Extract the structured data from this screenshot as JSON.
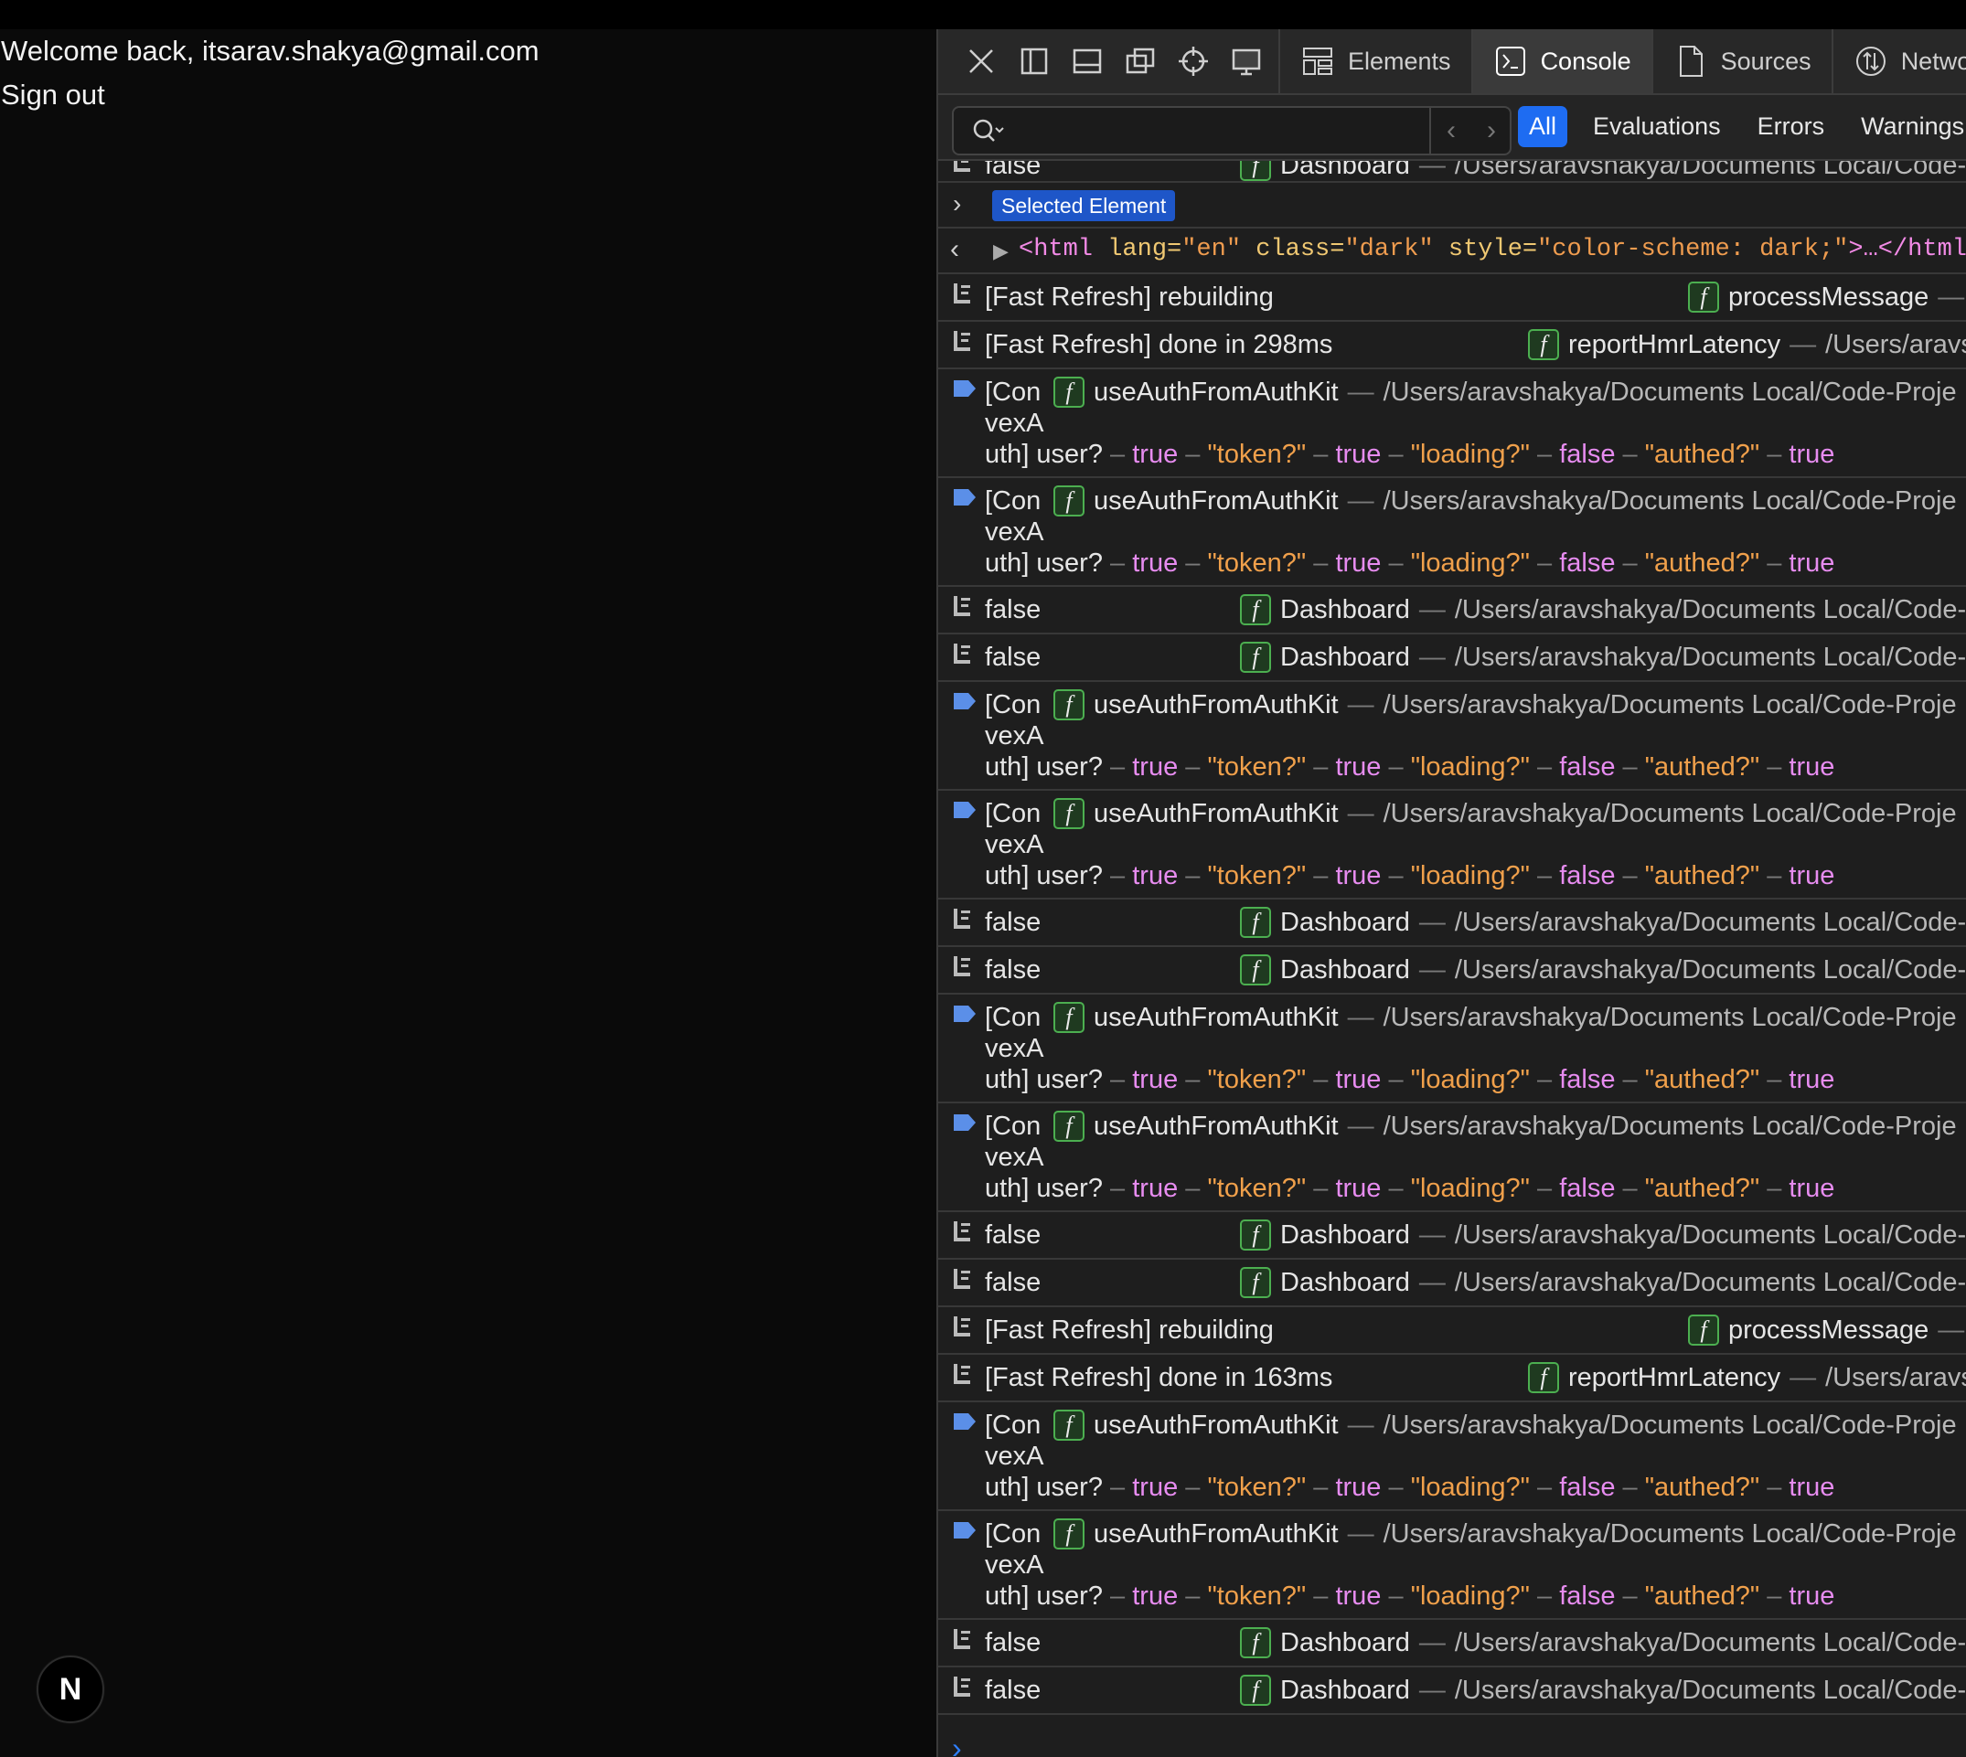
{
  "app": {
    "welcome": "Welcome back, itsarav.shakya@gmail.com",
    "sign_out": "Sign out",
    "badge": "N"
  },
  "devtools": {
    "tabs": [
      {
        "label": "Elements",
        "icon": "elements-icon"
      },
      {
        "label": "Console",
        "icon": "console-icon"
      },
      {
        "label": "Sources",
        "icon": "sources-icon"
      },
      {
        "label": "Netwo",
        "icon": "network-icon"
      }
    ],
    "search_placeholder": "",
    "filters": [
      "All",
      "Evaluations",
      "Errors",
      "Warnings"
    ],
    "selected_element_label": "Selected Element",
    "selected_html": {
      "open": "<html",
      "attr1": "lang=",
      "val1": "\"en\"",
      "attr2": "class=",
      "val2": "\"dark\"",
      "attr3": "style=",
      "val3": "\"color-scheme: dark;\"",
      "close": ">…</html>"
    },
    "common": {
      "dash": "—",
      "en_dash": "–",
      "false": "false",
      "true": "true",
      "dashboard_fn": "Dashboard",
      "dashboard_path": "/Users/aravshakya/Documents Local/Code-",
      "auth_fn": "useAuthFromAuthKit",
      "auth_path": "/Users/aravshakya/Documents Local/Code-Proje",
      "auth_line1": "[Con",
      "auth_line2": "vexA",
      "auth_line3_user": "uth] user?",
      "token": "\"token?\"",
      "loading": "\"loading?\"",
      "authed": "\"authed?\"",
      "process_fn": "processMessage",
      "hmr_fn": "reportHmrLatency",
      "hmr_path": "/Users/aravs"
    },
    "messages": {
      "rebuilding": "[Fast Refresh] rebuilding",
      "done_298": "[Fast Refresh] done in 298ms",
      "done_163": "[Fast Refresh] done in 163ms"
    }
  }
}
